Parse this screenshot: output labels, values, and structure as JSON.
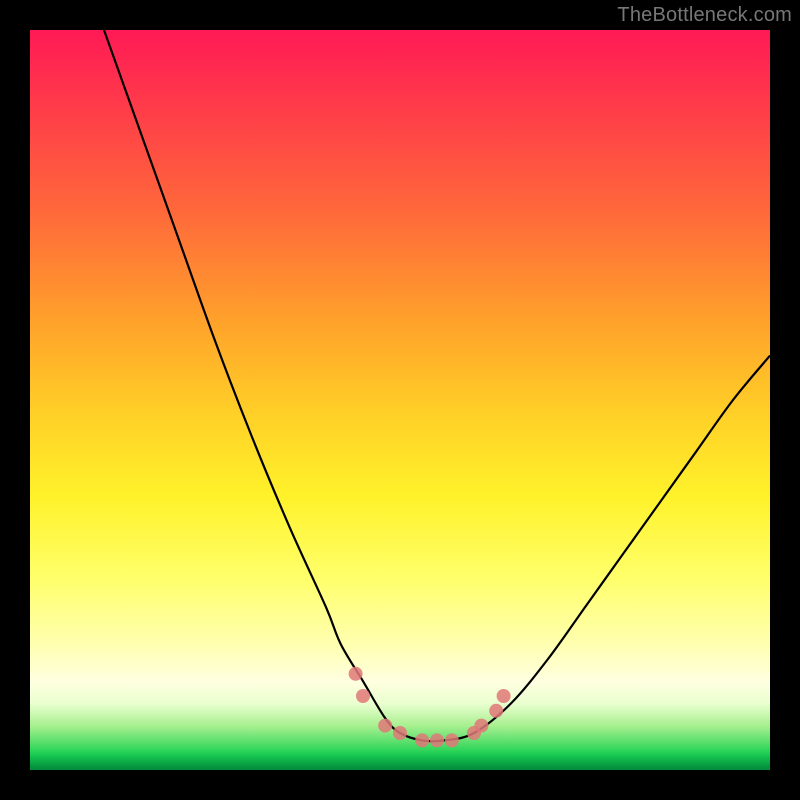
{
  "watermark": "TheBottleneck.com",
  "chart_data": {
    "type": "line",
    "title": "",
    "xlabel": "",
    "ylabel": "",
    "xlim": [
      0,
      100
    ],
    "ylim": [
      0,
      100
    ],
    "annotations": [],
    "background_gradient_stops": [
      {
        "pos": 0,
        "color": "#ff1a55"
      },
      {
        "pos": 10,
        "color": "#ff3a4a"
      },
      {
        "pos": 25,
        "color": "#ff6a3a"
      },
      {
        "pos": 40,
        "color": "#ffa42a"
      },
      {
        "pos": 52,
        "color": "#ffd027"
      },
      {
        "pos": 63,
        "color": "#fff22a"
      },
      {
        "pos": 74,
        "color": "#ffff6a"
      },
      {
        "pos": 83,
        "color": "#ffffb0"
      },
      {
        "pos": 88,
        "color": "#ffffe0"
      },
      {
        "pos": 91,
        "color": "#eaffd0"
      },
      {
        "pos": 94,
        "color": "#a8f090"
      },
      {
        "pos": 96.2,
        "color": "#5adf6c"
      },
      {
        "pos": 97.3,
        "color": "#2fd65a"
      },
      {
        "pos": 98.0,
        "color": "#18c753"
      },
      {
        "pos": 98.6,
        "color": "#0fb44a"
      },
      {
        "pos": 99.2,
        "color": "#0aa243"
      },
      {
        "pos": 99.6,
        "color": "#059440"
      },
      {
        "pos": 100,
        "color": "#028a3c"
      }
    ],
    "series": [
      {
        "name": "bottleneck-curve",
        "color": "#000000",
        "x": [
          10,
          15,
          20,
          25,
          30,
          35,
          40,
          42,
          45,
          48,
          50,
          53,
          56,
          60,
          65,
          70,
          75,
          80,
          85,
          90,
          95,
          100
        ],
        "y": [
          100,
          86,
          72,
          58,
          45,
          33,
          22,
          17,
          12,
          7,
          5,
          4,
          4,
          5,
          9,
          15,
          22,
          29,
          36,
          43,
          50,
          56
        ]
      }
    ],
    "markers": {
      "name": "curve-markers",
      "color": "#e07878",
      "radius": 7,
      "points_xy": [
        [
          44,
          13
        ],
        [
          45,
          10
        ],
        [
          48,
          6
        ],
        [
          50,
          5
        ],
        [
          53,
          4
        ],
        [
          55,
          4
        ],
        [
          57,
          4
        ],
        [
          60,
          5
        ],
        [
          61,
          6
        ],
        [
          63,
          8
        ],
        [
          64,
          10
        ]
      ]
    }
  }
}
